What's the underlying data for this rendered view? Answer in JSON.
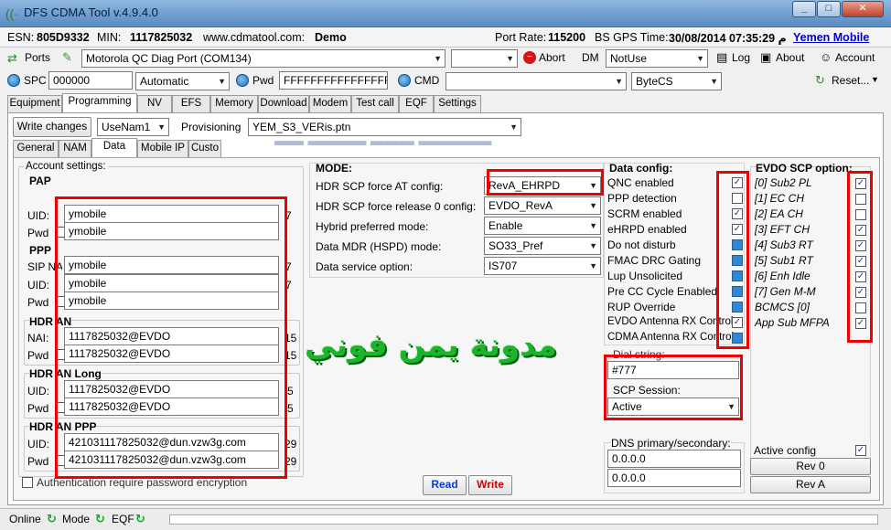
{
  "window": {
    "title": "DFS CDMA Tool v.4.9.4.0",
    "min": "_",
    "max": "□",
    "close": "✕"
  },
  "info": {
    "esn_label": "ESN:",
    "esn": "805D9332",
    "min_label": "MIN:",
    "min": "1117825032",
    "site": "www.cdmatool.com:",
    "mode": "Demo",
    "port_rate_label": "Port Rate:",
    "port_rate": "115200",
    "gps_label": "BS GPS Time:",
    "gps_time": "30/08/2014 07:35:29 م",
    "carrier": "Yemen Mobile"
  },
  "toolbar1": {
    "ports": "Ports",
    "port_select": "Motorola QC Diag Port (COM134)",
    "abort": "Abort",
    "dm_label": "DM",
    "dm_select": "NotUse",
    "log": "Log",
    "about": "About",
    "account": "Account"
  },
  "toolbar2": {
    "spc_label": "SPC",
    "spc_value": "000000",
    "spc_mode": "Automatic",
    "pwd_label": "Pwd",
    "pwd_value": "FFFFFFFFFFFFFFFF",
    "cmd_label": "CMD",
    "encoding": "ByteCS",
    "reset": "Reset..."
  },
  "main_tabs": [
    "Equipment",
    "Programming",
    "NV",
    "EFS",
    "Memory",
    "Download",
    "Modem",
    "Test call",
    "EQF",
    "Settings"
  ],
  "programming": {
    "write_changes": "Write changes",
    "user": "UseNam1",
    "provisioning_label": "Provisioning",
    "provisioning_file": "YEM_S3_VERis.ptn"
  },
  "sub_tabs": [
    "General",
    "NAM",
    "Data",
    "Mobile IP",
    "Custo"
  ],
  "account": {
    "title": "Account settings:",
    "pap": {
      "title": "PAP",
      "uid_label": "UID:",
      "uid": "ymobile",
      "pwd_label": "Pwd",
      "pwd": "ymobile",
      "uid_suffix": "7"
    },
    "ppp": {
      "title": "PPP",
      "nai_label": "SIP NAI",
      "nai": "ymobile",
      "uid_label": "UID:",
      "uid": "ymobile",
      "pwd_label": "Pwd",
      "pwd": "ymobile",
      "suffix1": "7",
      "suffix2": "7"
    },
    "hdr_an": {
      "title": "HDR AN",
      "nai_label": "NAI:",
      "nai": "1117825032@EVDO",
      "pwd_label": "Pwd",
      "pwd": "1117825032@EVDO",
      "suffix1": "15",
      "suffix2": "15"
    },
    "hdr_an_long": {
      "title": "HDR AN Long",
      "uid_label": "UID:",
      "uid": "1117825032@EVDO",
      "pwd_label": "Pwd",
      "pwd": "1117825032@EVDO",
      "suffix1": "5",
      "suffix2": "5"
    },
    "hdr_an_ppp": {
      "title": "HDR AN PPP",
      "uid_label": "UID:",
      "uid": "421031117825032@dun.vzw3g.com",
      "pwd_label": "Pwd",
      "pwd": "421031117825032@dun.vzw3g.com",
      "suffix1": "29",
      "suffix2": "29"
    },
    "auth_required": "Authentication require password encryption"
  },
  "mode": {
    "title": "MODE:",
    "rows": [
      {
        "label": "HDR SCP force AT config:",
        "value": "RevA_EHRPD"
      },
      {
        "label": "HDR SCP force release 0 config:",
        "value": "EVDO_RevA"
      },
      {
        "label": "Hybrid preferred mode:",
        "value": "Enable"
      },
      {
        "label": "Data MDR (HSPD) mode:",
        "value": "SO33_Pref"
      },
      {
        "label": "Data service option:",
        "value": "IS707"
      }
    ],
    "read": "Read",
    "write": "Write"
  },
  "data_config": {
    "title": "Data config:",
    "items": [
      {
        "label": "QNC enabled",
        "state": "checked"
      },
      {
        "label": "PPP detection",
        "state": "unchecked"
      },
      {
        "label": "SCRM enabled",
        "state": "checked"
      },
      {
        "label": "eHRPD enabled",
        "state": "checked"
      },
      {
        "label": "Do not disturb",
        "state": "filled"
      },
      {
        "label": "FMAC DRC Gating",
        "state": "filled"
      },
      {
        "label": "Lup Unsolicited",
        "state": "filled"
      },
      {
        "label": "Pre CC Cycle Enabled",
        "state": "filled"
      },
      {
        "label": "RUP Override",
        "state": "filled"
      },
      {
        "label": "EVDO Antenna RX Control",
        "state": "checked"
      },
      {
        "label": "CDMA Antenna RX Control",
        "state": "filled"
      }
    ],
    "dial_label": "Dial string:",
    "dial_value": "#777",
    "scp_session_label": "SCP Session:",
    "scp_session_value": "Active",
    "dns_label": "DNS primary/secondary:",
    "dns_primary": "0.0.0.0",
    "dns_secondary": "0.0.0.0"
  },
  "evdo_scp": {
    "title": "EVDO SCP option:",
    "items": [
      {
        "label": "[0] Sub2 PL",
        "checked": true
      },
      {
        "label": "[1] EC CH",
        "checked": false
      },
      {
        "label": "[2] EA CH",
        "checked": false
      },
      {
        "label": "[3] EFT CH",
        "checked": true
      },
      {
        "label": "[4] Sub3 RT",
        "checked": true
      },
      {
        "label": "[5] Sub1 RT",
        "checked": true
      },
      {
        "label": "[6] Enh Idle",
        "checked": true
      },
      {
        "label": "[7] Gen M-M",
        "checked": true
      },
      {
        "label": "BCMCS [0]",
        "checked": false
      },
      {
        "label": "App Sub MFPA",
        "checked": true
      }
    ],
    "active_config": "Active config",
    "rev0": "Rev 0",
    "reva": "Rev A"
  },
  "watermark": "مدونة يمن فوني",
  "status": {
    "online": "Online",
    "mode": "Mode",
    "eqf": "EQF"
  }
}
